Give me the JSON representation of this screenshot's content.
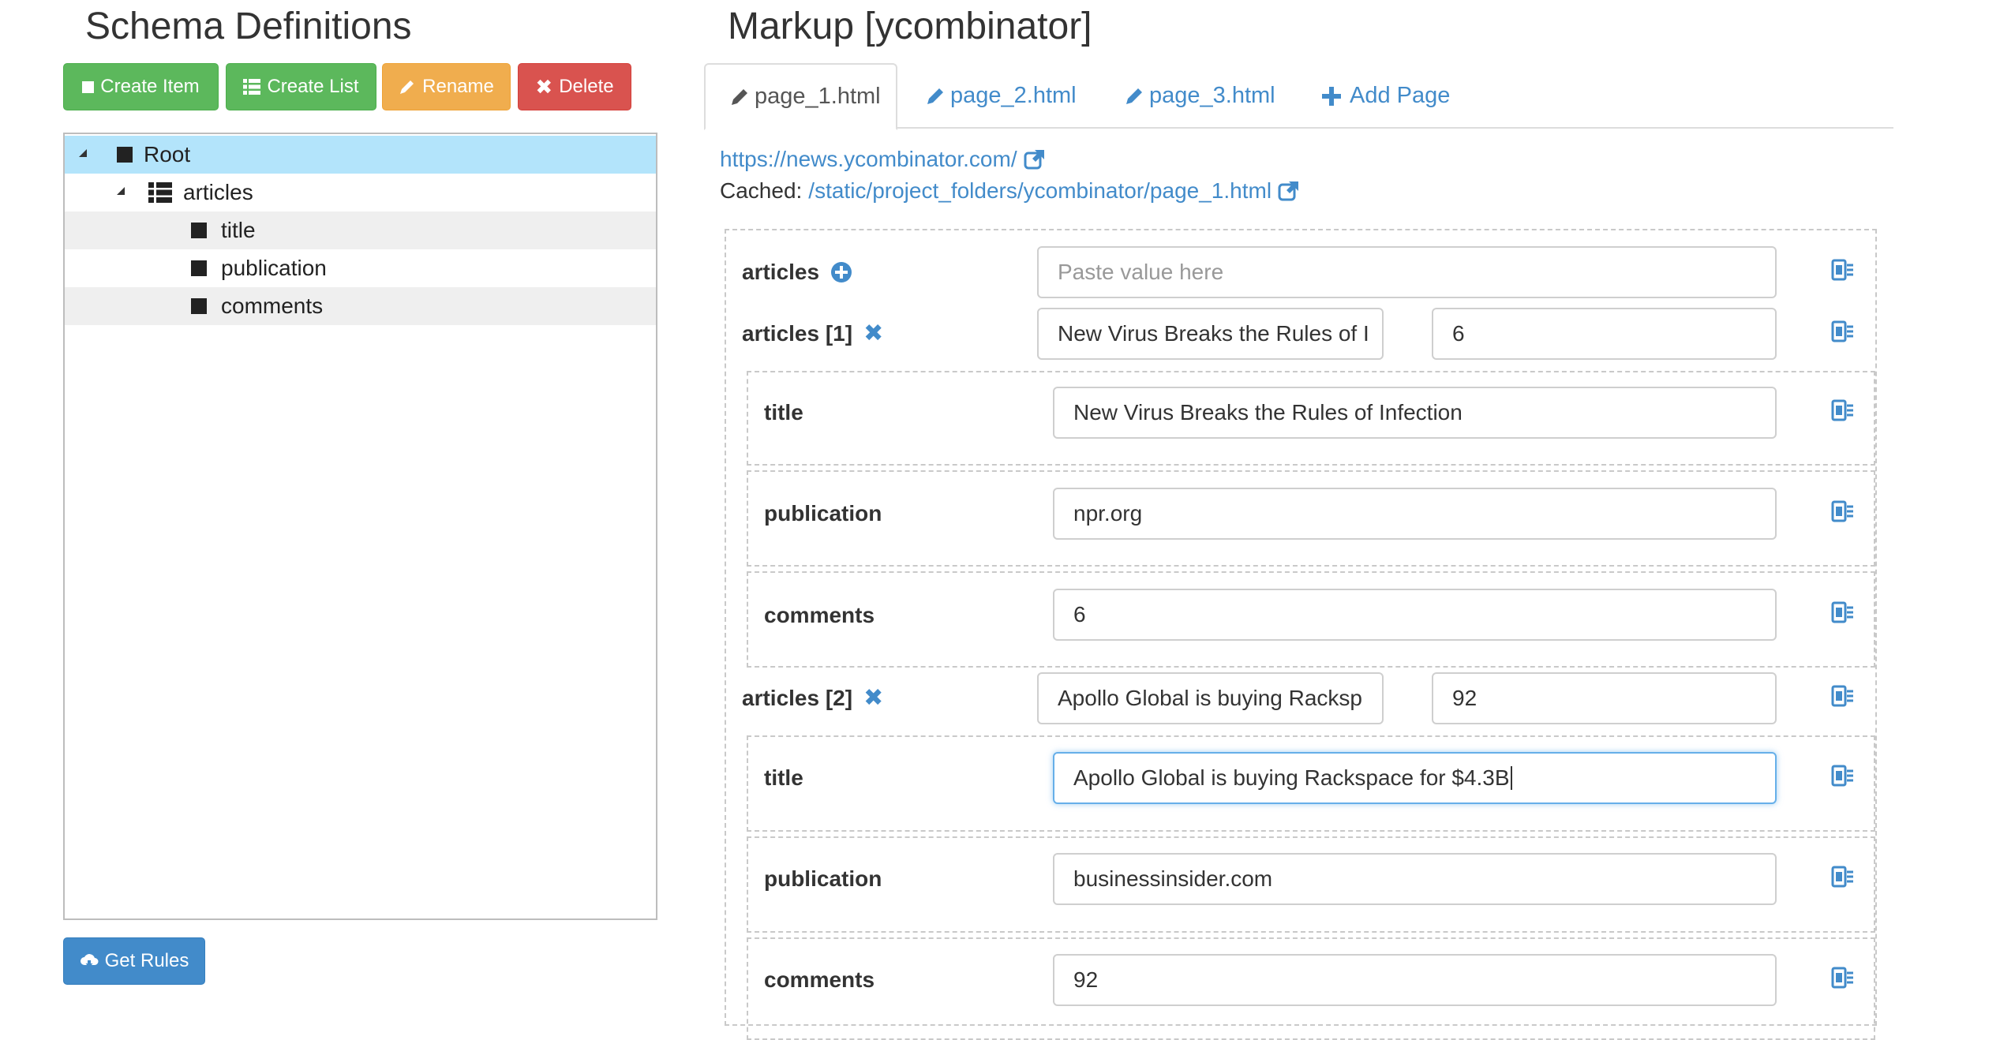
{
  "schema": {
    "title": "Schema Definitions",
    "buttons": {
      "create_item": "Create Item",
      "create_list": "Create List",
      "rename": "Rename",
      "delete": "Delete"
    },
    "tree": {
      "root": "Root",
      "articles": "articles",
      "title": "title",
      "publication": "publication",
      "comments": "comments"
    },
    "get_rules": "Get Rules"
  },
  "markup": {
    "title": "Markup [ycombinator]",
    "tabs": [
      "page_1.html",
      "page_2.html",
      "page_3.html"
    ],
    "add_page": "Add Page",
    "url": "https://news.ycombinator.com/",
    "cached_label": "Cached:",
    "cached_path": "/static/project_folders/ycombinator/page_1.html",
    "fields": {
      "articles_label": "articles",
      "articles_placeholder": "Paste value here",
      "articles_1": {
        "label": "articles [1]",
        "value_a": "New Virus Breaks the Rules of I",
        "value_b": "6",
        "title_label": "title",
        "title": "New Virus Breaks the Rules of Infection",
        "publication_label": "publication",
        "publication": "npr.org",
        "comments_label": "comments",
        "comments": "6"
      },
      "articles_2": {
        "label": "articles [2]",
        "value_a": "Apollo Global is buying Racksp",
        "value_b": "92",
        "title_label": "title",
        "title": "Apollo Global is buying Rackspace for $4.3B",
        "publication_label": "publication",
        "publication": "businessinsider.com",
        "comments_label": "comments",
        "comments": "92"
      }
    }
  },
  "colors": {
    "success": "#5cb85c",
    "warning": "#f0ad4e",
    "danger": "#d9534f",
    "primary": "#428bca",
    "tree_selected": "#b3e4fb"
  },
  "icons": {
    "create_item": "square-icon",
    "create_list": "list-icon",
    "rename": "pencil-icon",
    "delete": "x-icon",
    "get_rules": "cloud-download-icon",
    "add_page": "plus-icon",
    "external_link": "external-link-icon",
    "field_select": "selector-icon"
  }
}
